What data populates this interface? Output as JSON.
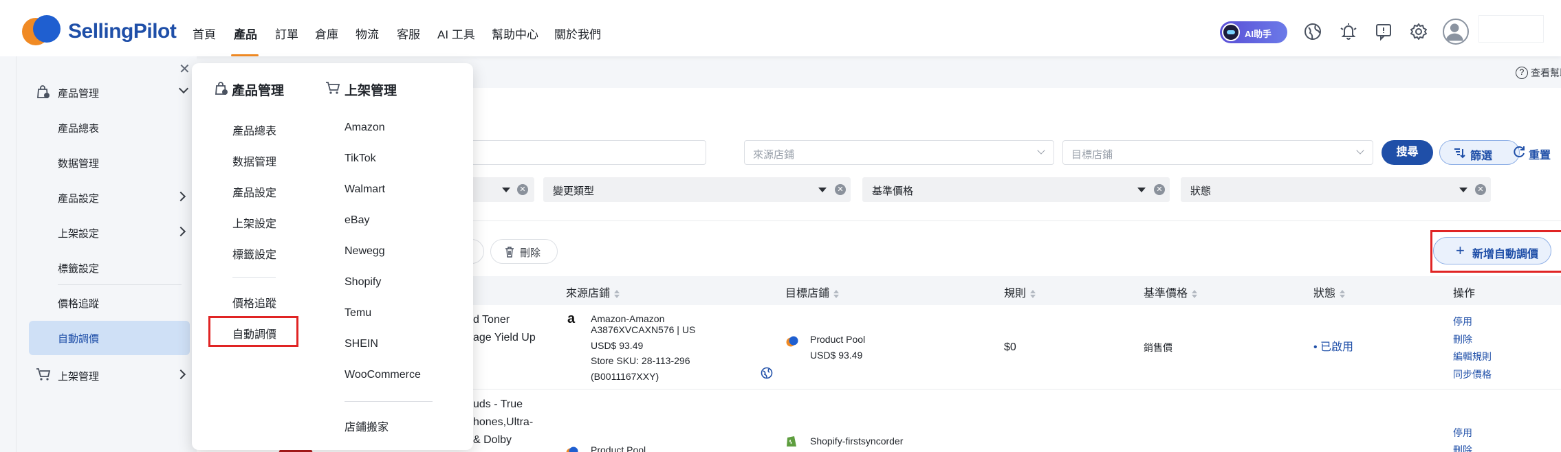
{
  "header": {
    "logo_text": "SellingPilot",
    "nav": [
      {
        "label": "首頁",
        "x": 0
      },
      {
        "label": "產品",
        "x": 0,
        "active": true
      },
      {
        "label": "訂單"
      },
      {
        "label": "倉庫"
      },
      {
        "label": "物流"
      },
      {
        "label": "客服"
      },
      {
        "label": "AI 工具"
      },
      {
        "label": "幫助中心"
      },
      {
        "label": "關於我們"
      }
    ],
    "ai_assistant_label": "AI助手"
  },
  "sidebar": {
    "group_product": "產品管理",
    "items": [
      "產品總表",
      "数据管理",
      "產品設定",
      "上架設定",
      "標籤設定",
      "價格追蹤",
      "自動調價"
    ],
    "group_listing": "上架管理"
  },
  "help_label": "查看幫助",
  "filters": {
    "source_store_placeholder": "來源店鋪",
    "target_store_placeholder": "目標店鋪",
    "search_label": "搜尋",
    "filter_label": "篩選",
    "reset_label": "重置",
    "tags": [
      "變更類型",
      "基準價格",
      "狀態"
    ]
  },
  "toolbar": {
    "delete_label": "刪除",
    "add_label": "新增自動調價"
  },
  "table": {
    "headers": [
      "來源店鋪",
      "目標店鋪",
      "規則",
      "基準價格",
      "狀態",
      "操作"
    ],
    "rows": [
      {
        "product_partial_1": "d Toner",
        "product_partial_2": "age Yield Up",
        "source_name": "Amazon-Amazon",
        "source_line2": "A3876XVCAXN576 | US",
        "source_price": "USD$ 93.49",
        "source_sku": "Store SKU: 28-113-296",
        "source_sku2": "(B0011167XXY)",
        "target_name": "Product Pool",
        "target_price": "USD$ 93.49",
        "rule": "$0",
        "base_price": "銷售價",
        "status": "已啟用",
        "actions": [
          "停用",
          "刪除",
          "編輯規則",
          "同步價格"
        ]
      },
      {
        "product_partial_1": "uds - True",
        "product_partial_2": "hones,Ultra-",
        "product_partial_3": "& Dolby",
        "source_name": "Product Pool",
        "target_name": "Shopify-firstsyncorder",
        "actions": [
          "停用",
          "刪除"
        ]
      }
    ]
  },
  "mega_menu": {
    "col1_title": "產品管理",
    "col1_items": [
      "產品總表",
      "数据管理",
      "產品設定",
      "上架設定",
      "標籤設定"
    ],
    "col1_items_b": [
      "價格追蹤",
      "自動調價"
    ],
    "col2_title": "上架管理",
    "col2_items": [
      "Amazon",
      "TikTok",
      "Walmart",
      "eBay",
      "Newegg",
      "Shopify",
      "Temu",
      "SHEIN",
      "WooCommerce"
    ],
    "col2_items_b": [
      "店鋪搬家"
    ]
  },
  "colors": {
    "brand_blue": "#1f4fa8",
    "accent_orange": "#f08a24",
    "highlight_red": "#e02424"
  }
}
